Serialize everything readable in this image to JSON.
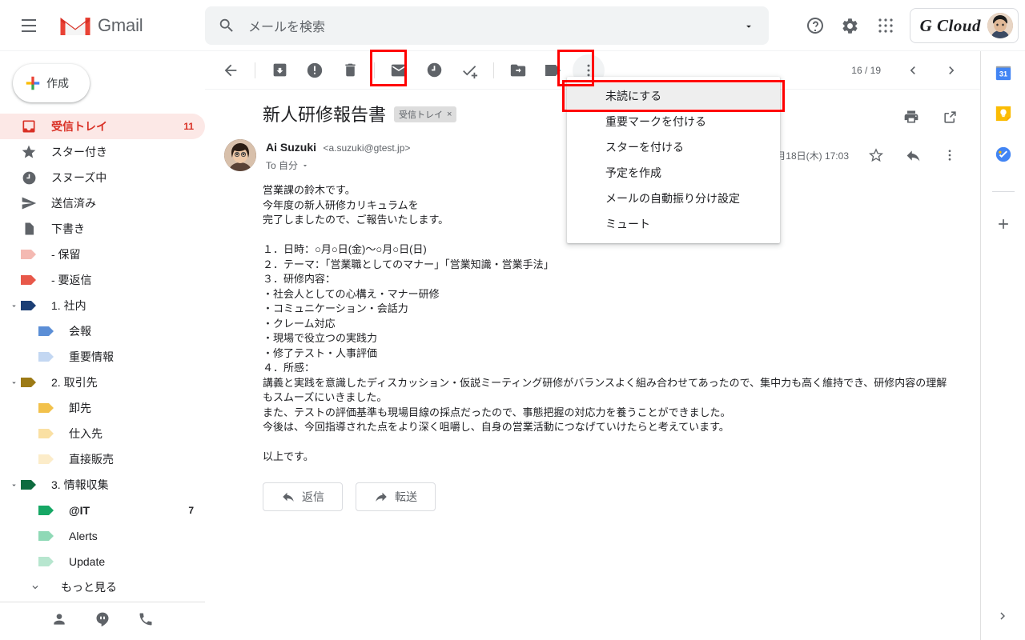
{
  "header": {
    "menu_icon": "hamburger-icon",
    "brand": "Gmail",
    "search": {
      "placeholder": "メールを検索",
      "value": "",
      "icon": "search-icon",
      "options_icon": "chevron-down-icon"
    },
    "help_icon": "help-icon",
    "settings_icon": "gear-icon",
    "apps_icon": "apps-grid-icon",
    "account_name": "G Cloud",
    "avatar": "user-avatar"
  },
  "sidebar": {
    "compose": {
      "label": "作成",
      "icon": "plus-icon"
    },
    "items": [
      {
        "label": "受信トレイ",
        "count": "11",
        "icon": "inbox-icon",
        "active": true,
        "level": 0,
        "color": "#d93025"
      },
      {
        "label": "スター付き",
        "count": "",
        "icon": "star-icon",
        "active": false,
        "level": 0
      },
      {
        "label": "スヌーズ中",
        "count": "",
        "icon": "clock-icon",
        "active": false,
        "level": 0
      },
      {
        "label": "送信済み",
        "count": "",
        "icon": "send-icon",
        "active": false,
        "level": 0
      },
      {
        "label": "下書き",
        "count": "",
        "icon": "draft-icon",
        "active": false,
        "level": 0
      },
      {
        "label": "- 保留",
        "count": "",
        "icon": "label-icon",
        "active": false,
        "level": 0,
        "color": "#f4b9b2"
      },
      {
        "label": "- 要返信",
        "count": "",
        "icon": "label-icon",
        "active": false,
        "level": 0,
        "color": "#e8584a"
      },
      {
        "label": "1. 社内",
        "count": "",
        "icon": "label-icon",
        "active": false,
        "level": 0,
        "color": "#1c3f75",
        "expandable": true
      },
      {
        "label": "会報",
        "count": "",
        "icon": "label-icon",
        "active": false,
        "level": 1,
        "color": "#5b8ed6"
      },
      {
        "label": "重要情報",
        "count": "",
        "icon": "label-icon",
        "active": false,
        "level": 1,
        "color": "#c3d7f2"
      },
      {
        "label": "2. 取引先",
        "count": "",
        "icon": "label-icon",
        "active": false,
        "level": 0,
        "color": "#9c7a15",
        "expandable": true
      },
      {
        "label": "卸先",
        "count": "",
        "icon": "label-icon",
        "active": false,
        "level": 1,
        "color": "#f2c14b"
      },
      {
        "label": "仕入先",
        "count": "",
        "icon": "label-icon",
        "active": false,
        "level": 1,
        "color": "#fae0a3"
      },
      {
        "label": "直接販売",
        "count": "",
        "icon": "label-icon",
        "active": false,
        "level": 1,
        "color": "#fcecc9"
      },
      {
        "label": "3. 情報収集",
        "count": "",
        "icon": "label-icon",
        "active": false,
        "level": 0,
        "color": "#0d6b3f",
        "expandable": true
      },
      {
        "label": "@IT",
        "count": "7",
        "icon": "label-icon",
        "active": false,
        "level": 1,
        "color": "#16a765",
        "bold": true
      },
      {
        "label": "Alerts",
        "count": "",
        "icon": "label-icon",
        "active": false,
        "level": 1,
        "color": "#8fd9b6"
      },
      {
        "label": "Update",
        "count": "",
        "icon": "label-icon",
        "active": false,
        "level": 1,
        "color": "#b7e6cf"
      },
      {
        "label": "もっと見る",
        "count": "",
        "icon": "chevron-down-icon",
        "active": false,
        "level": 0,
        "more": true
      }
    ],
    "footer_icons": [
      "contacts-icon",
      "hangouts-icon",
      "phone-icon"
    ]
  },
  "toolbar": {
    "back_icon": "back-arrow-icon",
    "archive_icon": "archive-icon",
    "spam_icon": "report-spam-icon",
    "delete_icon": "trash-icon",
    "mark_unread_icon": "mark-unread-icon",
    "snooze_icon": "snooze-clock-icon",
    "add_task_icon": "add-to-tasks-icon",
    "move_to_icon": "move-to-folder-icon",
    "labels_icon": "labels-tag-icon",
    "more_icon": "more-vertical-icon",
    "pager_text": "16 / 19",
    "prev_icon": "chevron-left-icon",
    "next_icon": "chevron-right-icon"
  },
  "more_menu": {
    "items": [
      {
        "label": "未読にする",
        "highlighted": true
      },
      {
        "label": "重要マークを付ける",
        "highlighted": false
      },
      {
        "label": "スターを付ける",
        "highlighted": false
      },
      {
        "label": "予定を作成",
        "highlighted": false
      },
      {
        "label": "メールの自動振り分け設定",
        "highlighted": false
      },
      {
        "label": "ミュート",
        "highlighted": false
      }
    ]
  },
  "email": {
    "subject": "新人研修報告書",
    "label_chip": "受信トレイ",
    "label_chip_remove": "×",
    "print_icon": "print-icon",
    "popout_icon": "open-in-new-icon",
    "sender_name": "Ai Suzuki",
    "sender_email": "<a.suzuki@gtest.jp>",
    "to_line": "To 自分",
    "date": "5月18日(木) 17:03",
    "star_icon": "star-outline-icon",
    "reply_icon": "reply-arrow-icon",
    "more_icon": "more-vertical-icon",
    "body": "営業課の鈴木です。\n今年度の新人研修カリキュラムを\n完了しましたので、ご報告いたします。\n\n１．日時：○月○日(金)〜○月○日(日)\n２．テーマ：「営業職としてのマナー」「営業知識・営業手法」\n３．研修内容：\n・社会人としての心構え・マナー研修\n・コミュニケーション・会話力\n・クレーム対応\n・現場で役立つの実践力\n・修了テスト・人事評価\n４．所感：\n講義と実践を意識したディスカッション・仮説ミーティング研修がバランスよく組み合わせてあったので、集中力も高く維持でき、研修内容の理解\nもスムーズにいきました。\nまた、テストの評価基準も現場目線の採点だったので、事態把握の対応力を養うことができました。\n今後は、今回指導された点をより深く咀嚼し、自身の営業活動につなげていけたらと考えています。\n\n以上です。",
    "reply_button": "返信",
    "forward_button": "転送"
  },
  "rail": {
    "calendar_icon": "google-calendar-icon",
    "calendar_day": "31",
    "keep_icon": "google-keep-icon",
    "tasks_icon": "google-tasks-icon",
    "add_icon": "plus-icon",
    "expand_icon": "chevron-right-icon"
  },
  "colors": {
    "accent_red": "#d93025",
    "highlight_box": "#ff0000",
    "inbox_active_bg": "#fce8e6",
    "text_primary": "#202124",
    "text_secondary": "#5f6368"
  }
}
